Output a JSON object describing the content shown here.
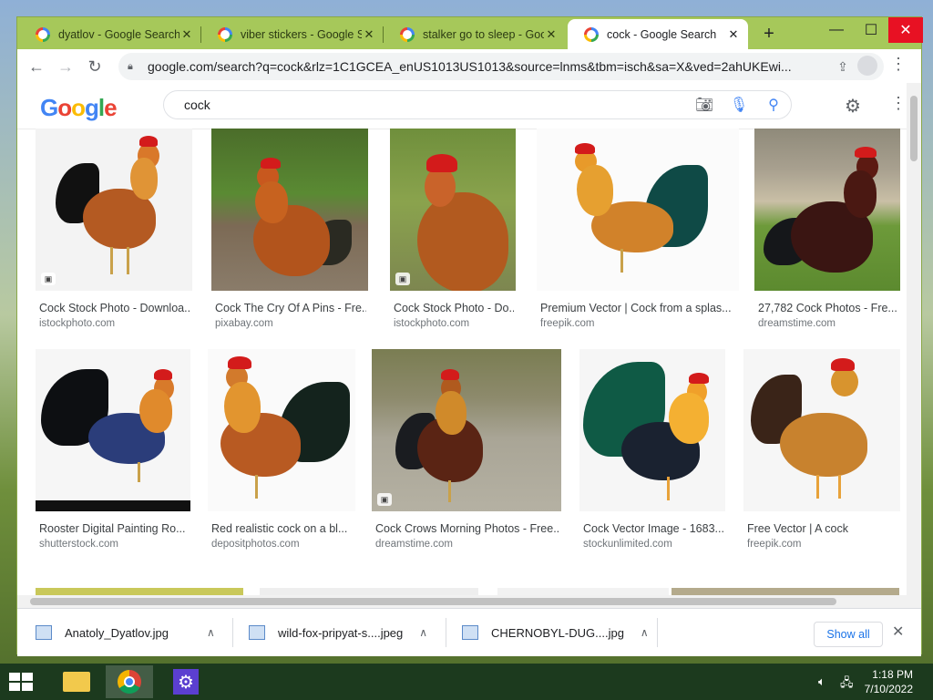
{
  "browser": {
    "tabs": [
      {
        "title": "dyatlov - Google Search",
        "active": false
      },
      {
        "title": "viber stickers - Google Se",
        "active": false
      },
      {
        "title": "stalker go to sleep - Goo",
        "active": false
      },
      {
        "title": "cock - Google Search",
        "active": true
      }
    ],
    "new_tab_label": "+",
    "window_controls": {
      "minimize": "—",
      "maximize": "☐",
      "close": "✕"
    },
    "url": "google.com/search?q=cock&rlz=1C1GCEA_enUS1013US1013&source=lnms&tbm=isch&sa=X&ved=2ahUKEwi..."
  },
  "search": {
    "logo_letters": [
      "G",
      "o",
      "o",
      "g",
      "l",
      "e"
    ],
    "query": "cock"
  },
  "results": [
    {
      "title": "Cock Stock Photo - Downloa...",
      "source": "istockphoto.com"
    },
    {
      "title": "Cock The Cry Of A Pins - Fre...",
      "source": "pixabay.com"
    },
    {
      "title": "Cock Stock Photo - Do...",
      "source": "istockphoto.com"
    },
    {
      "title": "Premium Vector | Cock from a splas...",
      "source": "freepik.com"
    },
    {
      "title": "27,782 Cock Photos - Fre...",
      "source": "dreamstime.com"
    },
    {
      "title": "Rooster Digital Painting Ro...",
      "source": "shutterstock.com"
    },
    {
      "title": "Red realistic cock on a bl...",
      "source": "depositphotos.com"
    },
    {
      "title": "Cock Crows Morning Photos - Free...",
      "source": "dreamstime.com"
    },
    {
      "title": "Cock Vector Image - 1683...",
      "source": "stockunlimited.com"
    },
    {
      "title": "Free Vector | A cock",
      "source": "freepik.com"
    }
  ],
  "downloads": {
    "items": [
      {
        "name": "Anatoly_Dyatlov.jpg"
      },
      {
        "name": "wild-fox-pripyat-s....jpeg"
      },
      {
        "name": "CHERNOBYL-DUG....jpg"
      }
    ],
    "show_all": "Show all"
  },
  "taskbar": {
    "time": "1:18 PM",
    "date": "7/10/2022"
  },
  "colors": {
    "accent": "#1a73e8",
    "frame": "#a6c85a",
    "close_red": "#e81123"
  }
}
